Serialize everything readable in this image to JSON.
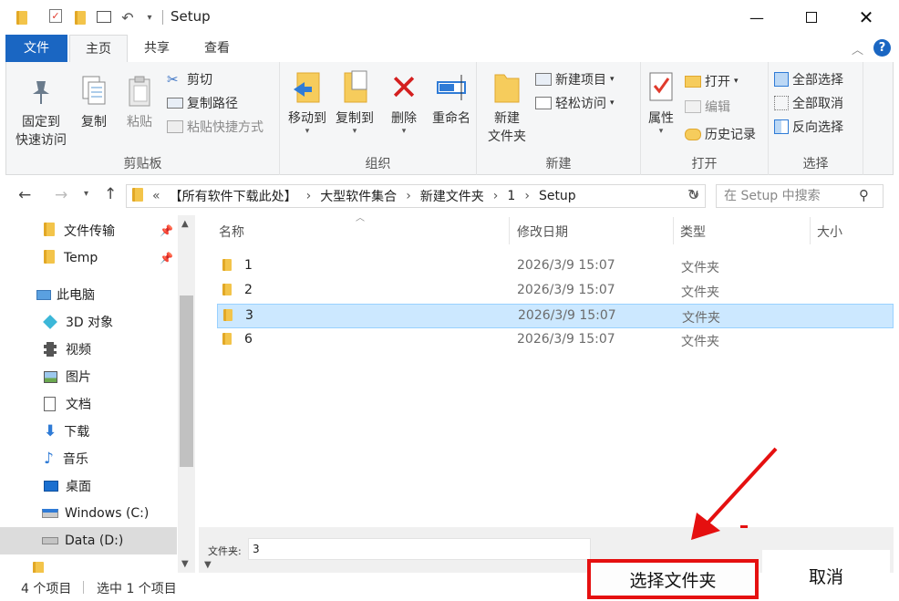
{
  "window": {
    "title": "Setup"
  },
  "tabs": [
    "文件",
    "主页",
    "共享",
    "查看"
  ],
  "ribbon": {
    "clipboard": {
      "label": "剪贴板",
      "pin": [
        "固定到",
        "快速访问"
      ],
      "copy": "复制",
      "paste": "粘贴",
      "cut": "剪切",
      "copy_path": "复制路径",
      "paste_shortcut": "粘贴快捷方式"
    },
    "organize": {
      "label": "组织",
      "move_to": "移动到",
      "copy_to": "复制到",
      "delete": "删除",
      "rename": "重命名"
    },
    "new": {
      "label": "新建",
      "new_folder": [
        "新建",
        "文件夹"
      ],
      "new_item": "新建项目",
      "easy_access": "轻松访问"
    },
    "open": {
      "label": "打开",
      "properties": "属性",
      "open": "打开",
      "edit": "编辑",
      "history": "历史记录"
    },
    "select": {
      "label": "选择",
      "select_all": "全部选择",
      "select_none": "全部取消",
      "invert": "反向选择"
    }
  },
  "address": {
    "crumbs": [
      "【所有软件下载此处】",
      "大型软件集合",
      "新建文件夹",
      "1",
      "Setup"
    ],
    "search_placeholder": "在 Setup 中搜索"
  },
  "nav": {
    "quick": [
      {
        "label": "文件传输"
      },
      {
        "label": "Temp"
      }
    ],
    "pc": "此电脑",
    "items": [
      "3D 对象",
      "视频",
      "图片",
      "文档",
      "下载",
      "音乐",
      "桌面",
      "Windows (C:)",
      "Data (D:)"
    ]
  },
  "columns": {
    "name": "名称",
    "date": "修改日期",
    "type": "类型",
    "size": "大小"
  },
  "files": [
    {
      "name": "1",
      "date": "2026/3/9 15:07",
      "type": "文件夹"
    },
    {
      "name": "2",
      "date": "2026/3/9 15:07",
      "type": "文件夹"
    },
    {
      "name": "3",
      "date": "2026/3/9 15:07",
      "type": "文件夹"
    },
    {
      "name": "6",
      "date": "2026/3/9 15:07",
      "type": "文件夹"
    }
  ],
  "dialog": {
    "folder_label": "文件夹:",
    "folder_value": "3",
    "select_button": "选择文件夹",
    "cancel_button": "取消"
  },
  "status": {
    "count": "4 个项目",
    "selected": "选中 1 个项目"
  },
  "colors": {
    "accent": "#1a66c2",
    "selection": "#cce8ff",
    "highlight": "#e51010"
  }
}
